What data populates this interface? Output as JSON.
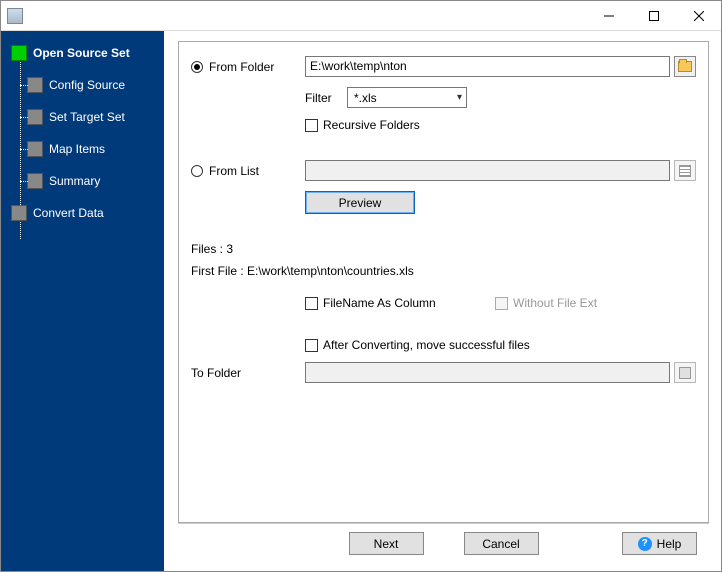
{
  "sidebar": {
    "items": [
      {
        "label": "Open Source Set",
        "active": true
      },
      {
        "label": "Config Source"
      },
      {
        "label": "Set Target Set"
      },
      {
        "label": "Map Items"
      },
      {
        "label": "Summary"
      },
      {
        "label": "Convert Data"
      }
    ]
  },
  "source": {
    "from_folder_label": "From Folder",
    "from_folder_path": "E:\\work\\temp\\nton",
    "filter_label": "Filter",
    "filter_value": "*.xls",
    "recursive_label": "Recursive Folders",
    "from_list_label": "From List",
    "preview_label": "Preview"
  },
  "files": {
    "count_label": "Files : 3",
    "first_file_label": "First File : E:\\work\\temp\\nton\\countries.xls",
    "filename_col_label": "FileName As Column",
    "without_ext_label": "Without File Ext",
    "after_convert_label": "After Converting, move successful files",
    "to_folder_label": "To Folder"
  },
  "footer": {
    "next": "Next",
    "cancel": "Cancel",
    "help": "Help"
  }
}
